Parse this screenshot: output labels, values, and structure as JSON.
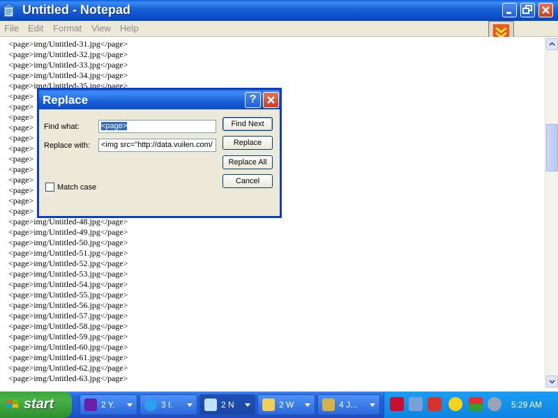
{
  "window": {
    "title": "Untitled - Notepad"
  },
  "menu": [
    "File",
    "Edit",
    "Format",
    "View",
    "Help"
  ],
  "editor_lines": [
    "<page>img/Untitled-31.jpg</page>",
    "<page>img/Untitled-32.jpg</page>",
    "<page>img/Untitled-33.jpg</page>",
    "<page>img/Untitled-34.jpg</page>",
    "<page>img/Untitled-35.jpg</page>",
    "<page>",
    "<page>",
    "<page>",
    "<page>",
    "<page>",
    "<page>",
    "<page>",
    "<page>",
    "<page>",
    "<page>",
    "<page>",
    "<page>",
    "<page>img/Untitled-48.jpg</page>",
    "<page>img/Untitled-49.jpg</page>",
    "<page>img/Untitled-50.jpg</page>",
    "<page>img/Untitled-51.jpg</page>",
    "<page>img/Untitled-52.jpg</page>",
    "<page>img/Untitled-53.jpg</page>",
    "<page>img/Untitled-54.jpg</page>",
    "<page>img/Untitled-55.jpg</page>",
    "<page>img/Untitled-56.jpg</page>",
    "<page>img/Untitled-57.jpg</page>",
    "<page>img/Untitled-58.jpg</page>",
    "<page>img/Untitled-59.jpg</page>",
    "<page>img/Untitled-60.jpg</page>",
    "<page>img/Untitled-61.jpg</page>",
    "<page>img/Untitled-62.jpg</page>",
    "<page>img/Untitled-63.jpg</page>"
  ],
  "dialog": {
    "title": "Replace",
    "help_label": "?",
    "find_label": "Find what:",
    "find_value": "<page>",
    "replace_label": "Replace with:",
    "replace_value": "<img src=\"http://data.vuilen.com/",
    "match_case_label": "Match case",
    "match_case_checked": false,
    "buttons": {
      "find_next": "Find Next",
      "replace": "Replace",
      "replace_all": "Replace All",
      "cancel": "Cancel"
    }
  },
  "taskbar": {
    "start_label": "start",
    "tasks": [
      {
        "label": "2 Y.",
        "icon": "yahoo-messenger-icon",
        "active": false
      },
      {
        "label": "3 I.",
        "icon": "internet-explorer-icon",
        "active": false
      },
      {
        "label": "2 N",
        "icon": "notepad-icon",
        "active": true
      },
      {
        "label": "2 W",
        "icon": "folder-icon",
        "active": false
      },
      {
        "label": "4 J...",
        "icon": "paint-icon",
        "active": false
      }
    ],
    "tray_icons": [
      "v-antivirus-icon",
      "network-icon",
      "download-manager-icon",
      "yahoo-smiley-icon",
      "sync-arrows-icon",
      "speaker-icon"
    ],
    "clock": "5:29 AM"
  },
  "colors": {
    "titlebar": "#0b4fc9",
    "dialog_border": "#0a3ec4",
    "selection": "#316ac5",
    "taskbar": "#2157d0",
    "start": "#3aa63a",
    "tray": "#0e85e0"
  }
}
